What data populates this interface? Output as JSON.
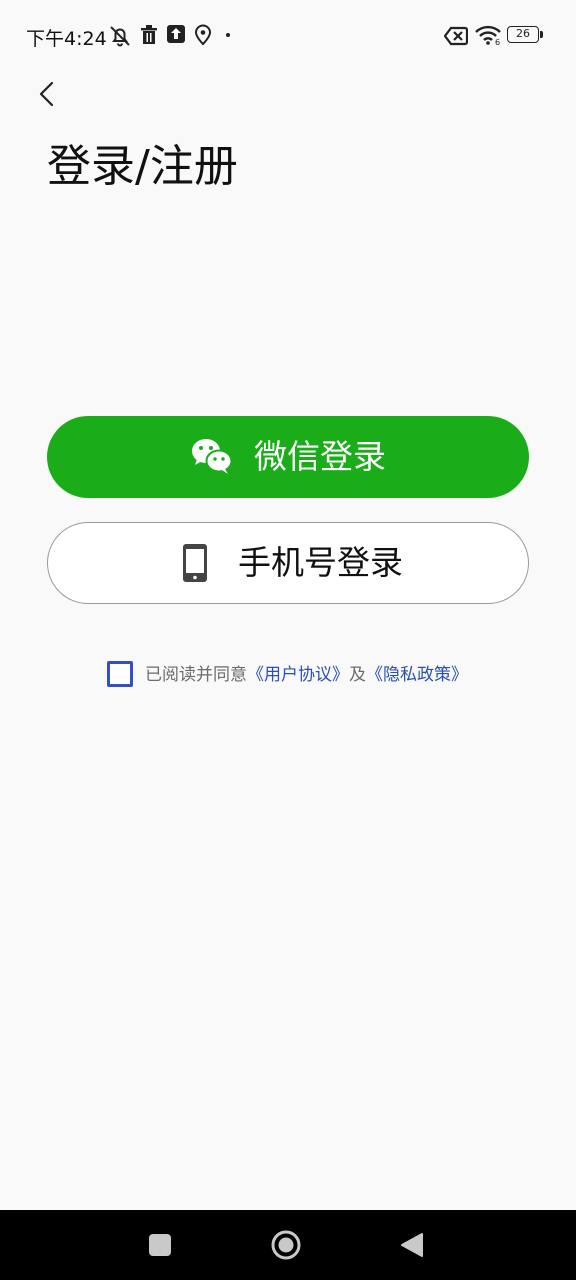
{
  "status_bar": {
    "time": "下午4:24",
    "battery": "26",
    "icons": [
      "mute-bell-icon",
      "trash-icon",
      "upload-icon",
      "location-icon",
      "dot-icon",
      "no-sim-icon",
      "wifi-icon",
      "battery-icon"
    ]
  },
  "header": {
    "back_icon": "chevron-left-icon",
    "title": "登录/注册"
  },
  "login": {
    "wechat_label": "微信登录",
    "wechat_icon": "wechat-icon",
    "wechat_color": "#1aad19",
    "phone_label": "手机号登录",
    "phone_icon": "smartphone-icon"
  },
  "agreement": {
    "checked": false,
    "prefix": "已阅读并同意",
    "user_agreement": "《用户协议》",
    "conjunction": "及",
    "privacy_policy": "《隐私政策》",
    "link_color": "#2b4fb0"
  },
  "nav_bar": {
    "icons": [
      "square-recents-icon",
      "circle-home-icon",
      "triangle-back-icon"
    ]
  }
}
